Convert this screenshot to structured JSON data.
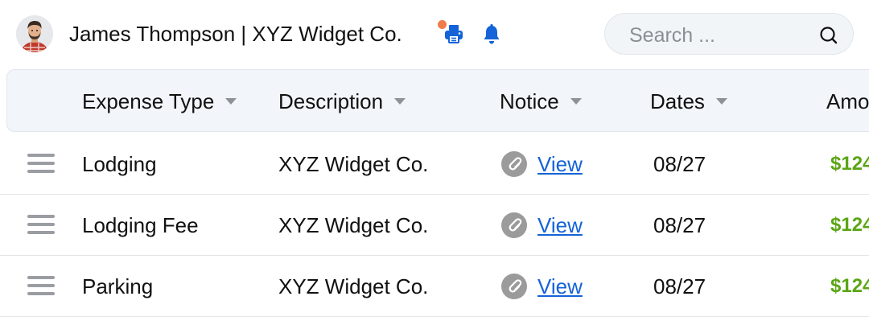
{
  "header": {
    "user_title": "James Thompson | XYZ Widget Co.",
    "search_placeholder": "Search ..."
  },
  "icons": {
    "printer": "printer-icon",
    "bell": "bell-icon",
    "search": "search-icon",
    "drag": "drag-handle-icon",
    "notice": "link-icon"
  },
  "colors": {
    "accent_blue": "#1463d8",
    "notification_dot": "#f07c4a",
    "amount_green": "#5aa514",
    "link_blue": "#1463d8"
  },
  "table": {
    "columns": [
      {
        "label": "Expense Type"
      },
      {
        "label": "Description"
      },
      {
        "label": "Notice"
      },
      {
        "label": "Dates"
      },
      {
        "label": "Amo"
      }
    ],
    "rows": [
      {
        "expense_type": "Lodging",
        "description": "XYZ Widget Co.",
        "notice_link": "View",
        "date": "08/27",
        "amount": "$124"
      },
      {
        "expense_type": "Lodging Fee",
        "description": "XYZ Widget Co.",
        "notice_link": "View",
        "date": "08/27",
        "amount": "$124"
      },
      {
        "expense_type": "Parking",
        "description": "XYZ Widget Co.",
        "notice_link": "View",
        "date": "08/27",
        "amount": "$124"
      }
    ]
  }
}
